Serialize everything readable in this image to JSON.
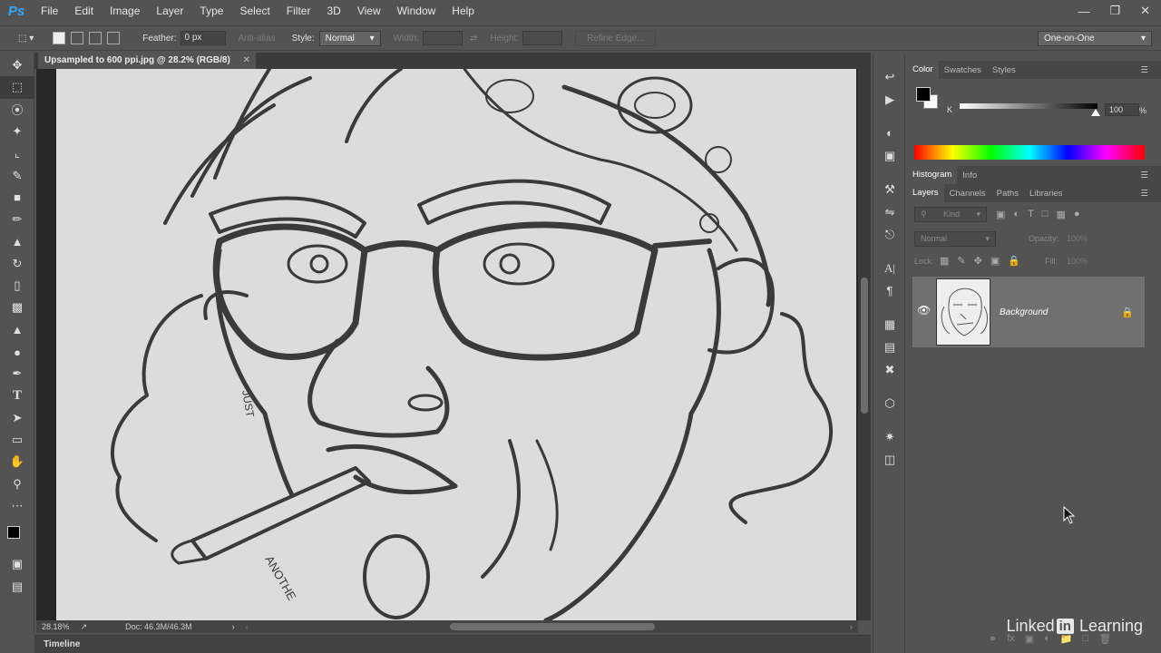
{
  "app": {
    "logo": "Ps"
  },
  "menu": [
    "File",
    "Edit",
    "Image",
    "Layer",
    "Type",
    "Select",
    "Filter",
    "3D",
    "View",
    "Window",
    "Help"
  ],
  "options": {
    "feather_label": "Feather:",
    "feather_value": "0 px",
    "anti_alias": "Anti-alias",
    "style_label": "Style:",
    "style_value": "Normal",
    "width_label": "Width:",
    "height_label": "Height:",
    "refine_edge": "Refine Edge...",
    "workspace": "One-on-One"
  },
  "document": {
    "tab_title": "Upsampled to 600 ppi.jpg @ 28.2% (RGB/8)",
    "zoom": "28.18%",
    "doc_info": "Doc: 46.3M/46.3M"
  },
  "timeline_label": "Timeline",
  "color_panel": {
    "tabs": [
      "Color",
      "Swatches",
      "Styles"
    ],
    "channel": "K",
    "value": "100",
    "unit": "%",
    "foreground": "#000000",
    "background": "#ffffff"
  },
  "histogram_panel": {
    "tabs": [
      "Histogram",
      "Info"
    ]
  },
  "layers_panel": {
    "tabs": [
      "Layers",
      "Channels",
      "Paths",
      "Libraries"
    ],
    "filter_kind": "Kind",
    "blend_mode": "Normal",
    "opacity_label": "Opacity:",
    "opacity_value": "100%",
    "lock_label": "Lock:",
    "fill_label": "Fill:",
    "fill_value": "100%",
    "layers": [
      {
        "name": "Background",
        "visible": true,
        "locked": true
      }
    ]
  },
  "watermark": {
    "linked": "Linked",
    "in": "in",
    "learning": "Learning"
  }
}
